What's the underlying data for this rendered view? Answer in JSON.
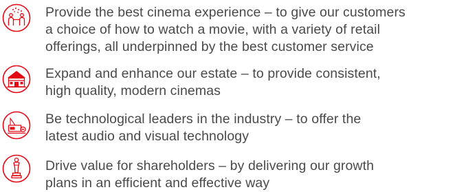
{
  "accent_color": "#e30613",
  "text_color": "#4a4a4a",
  "items": [
    {
      "icon": "cinema-experience-icon",
      "lines": [
        "Provide the best cinema experience – to give our customers",
        "a choice of how to watch a movie, with a variety of retail",
        "offerings, all underpinned by the best customer service"
      ]
    },
    {
      "icon": "cinema-building-icon",
      "lines": [
        "Expand and enhance our estate – to provide consistent,",
        "high quality, modern cinemas"
      ]
    },
    {
      "icon": "projector-icon",
      "lines": [
        "Be technological leaders in the industry – to offer the",
        "latest audio and visual technology"
      ]
    },
    {
      "icon": "award-statuette-icon",
      "lines": [
        "Drive value for shareholders – by delivering our growth",
        "plans in an efficient and effective way"
      ]
    }
  ]
}
